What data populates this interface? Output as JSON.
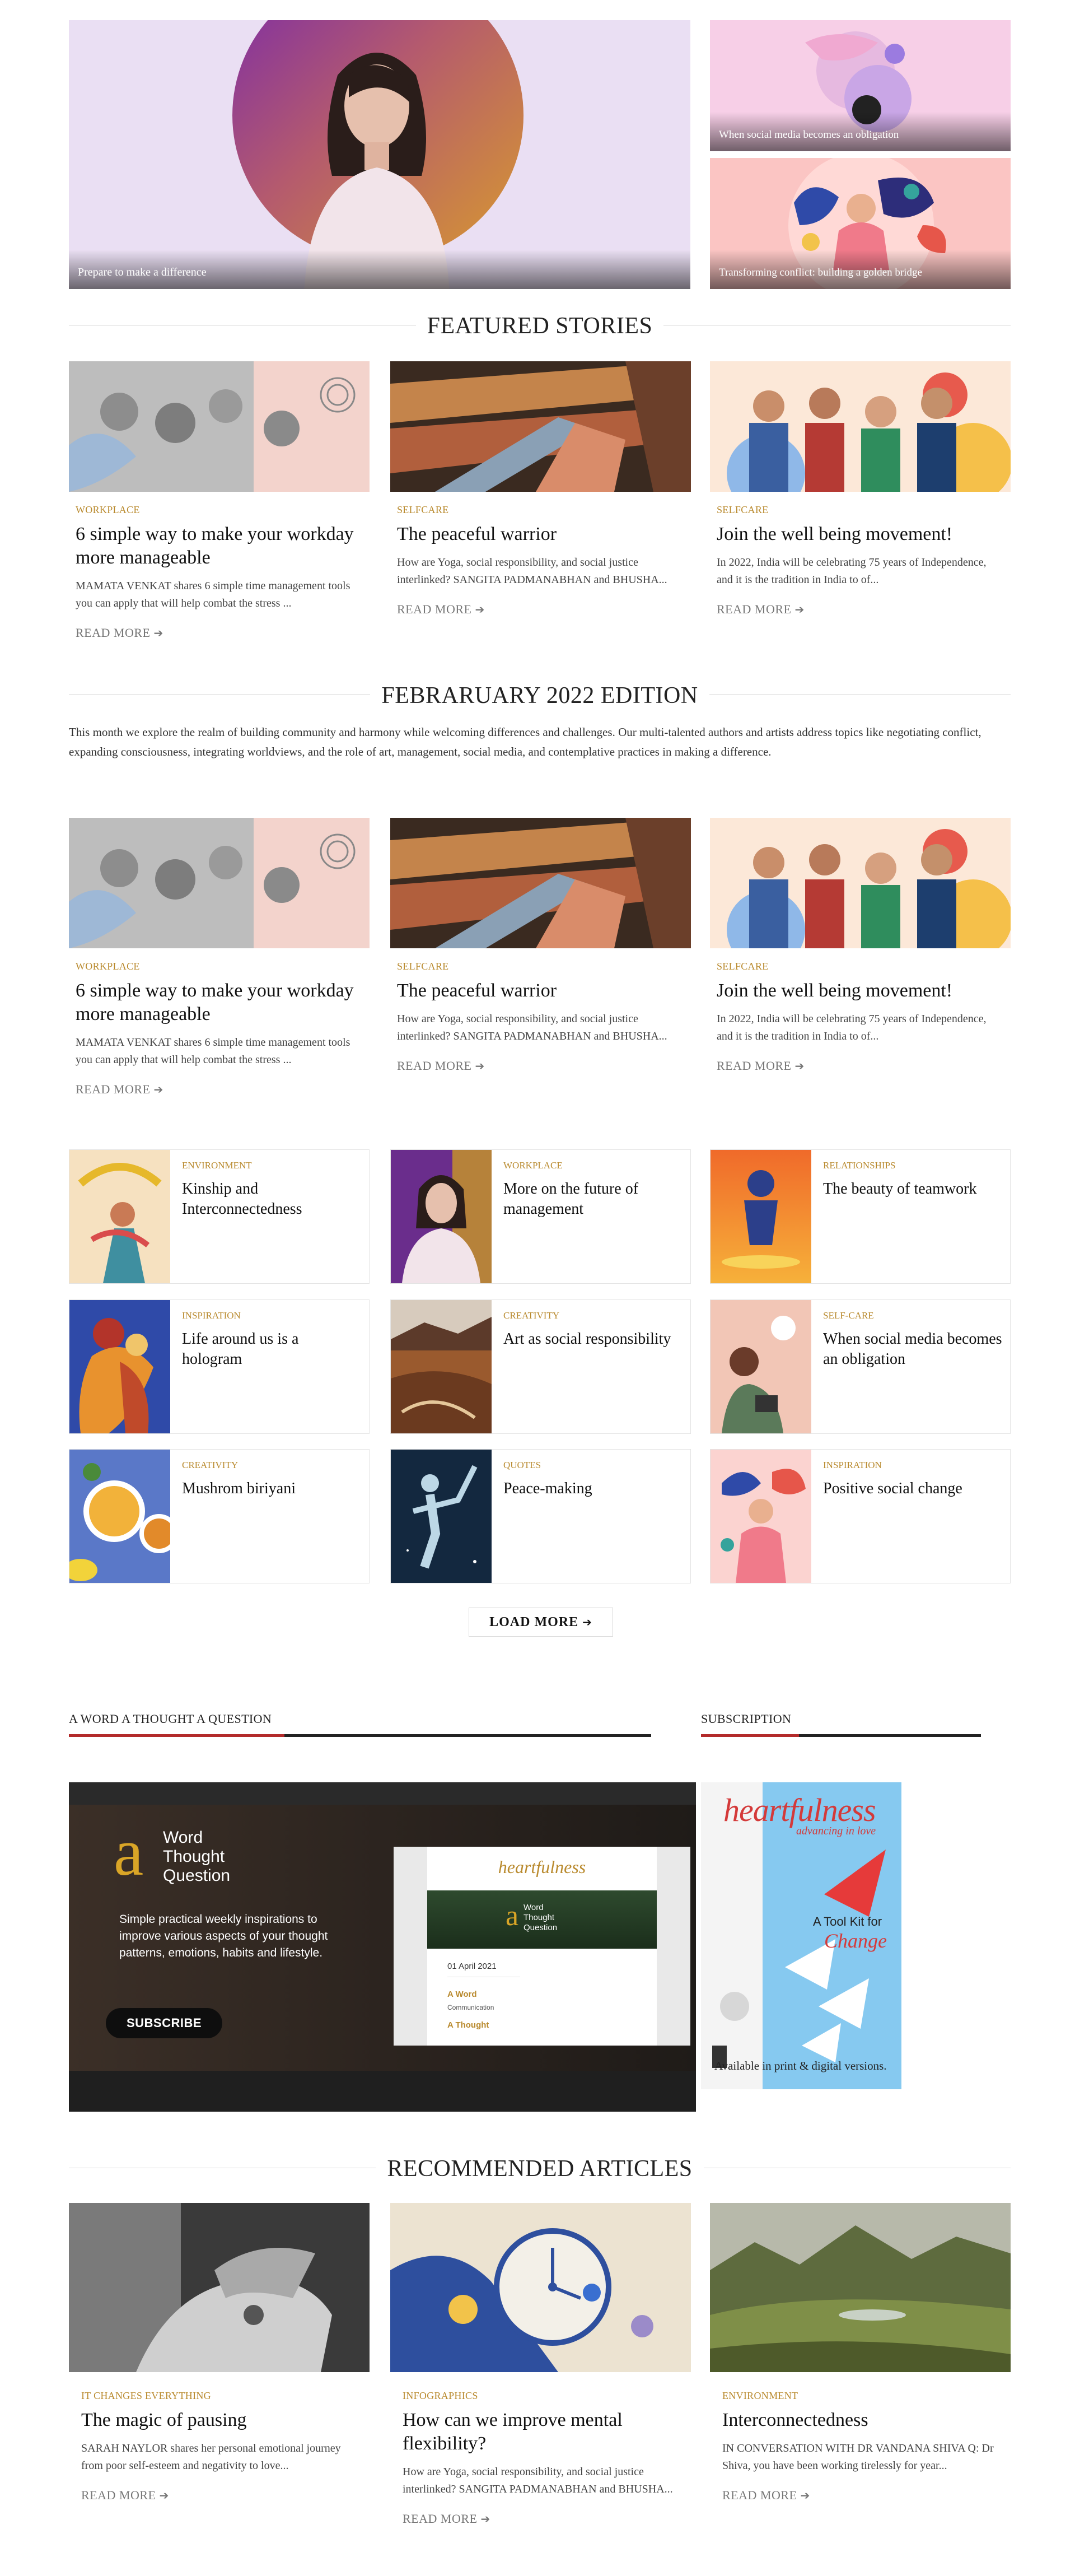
{
  "hero": {
    "main_caption": "Prepare to make a difference",
    "side1_caption": "When social media becomes an obligation",
    "side2_caption": "Transforming conflict: building a golden bridge"
  },
  "featured": {
    "heading": "FEATURED STORIES",
    "cards": [
      {
        "category": "WORKPLACE",
        "title": "6 simple way to make your workday more manageable",
        "excerpt": "MAMATA VENKAT shares 6 simple time management tools you can apply that will help combat the stress ...",
        "read_more": "READ MORE"
      },
      {
        "category": "SELFCARE",
        "title": "The peaceful warrior",
        "excerpt": "How are Yoga, social responsibility, and social justice interlinked? SANGITA PADMANABHAN and BHUSHA...",
        "read_more": "READ MORE"
      },
      {
        "category": "SELFCARE",
        "title": "Join the well being movement!",
        "excerpt": "In 2022, India will be celebrating 75 years of Independence, and it is the tradition in India to of...",
        "read_more": "READ MORE"
      }
    ]
  },
  "edition": {
    "heading": "FEBRARUARY 2022 EDITION",
    "intro": "This month we explore the realm of building community and harmony while welcoming differences and challenges. Our multi-talented authors and artists address topics like negotiating conflict, expanding consciousness, integrating worldviews, and the role of art, management, social media, and contemplative practices in making a difference.",
    "cards": [
      {
        "category": "WORKPLACE",
        "title": "6 simple way to make your workday more manageable",
        "excerpt": "MAMATA VENKAT shares 6 simple time management tools you can apply that will help combat the stress ...",
        "read_more": "READ MORE"
      },
      {
        "category": "SELFCARE",
        "title": "The peaceful warrior",
        "excerpt": "How are Yoga, social responsibility, and social justice interlinked? SANGITA PADMANABHAN and BHUSHA...",
        "read_more": "READ MORE"
      },
      {
        "category": "SELFCARE",
        "title": "Join the well being movement!",
        "excerpt": "In 2022, India will be celebrating 75 years of Independence, and it is the tradition in India to of...",
        "read_more": "READ MORE"
      }
    ],
    "tiles": [
      {
        "category": "ENVIRONMENT",
        "title": "Kinship and Interconnectedness"
      },
      {
        "category": "WORKPLACE",
        "title": "More on the future of management"
      },
      {
        "category": "RELATIONSHIPS",
        "title": "The beauty of teamwork"
      },
      {
        "category": "INSPIRATION",
        "title": "Life around us is a hologram"
      },
      {
        "category": "CREATIVITY",
        "title": "Art as social responsibility"
      },
      {
        "category": "SELF-CARE",
        "title": "When social media becomes an obligation"
      },
      {
        "category": "CREATIVITY",
        "title": "Mushrom biriyani"
      },
      {
        "category": "QUOTES",
        "title": "Peace-making"
      },
      {
        "category": "INSPIRATION",
        "title": "Positive social change"
      }
    ],
    "load_more": "LOAD MORE"
  },
  "word_thought": {
    "heading": "A WORD A THOUGHT A QUESTION",
    "logo_letter": "a",
    "logo_words": [
      "Word",
      "Thought",
      "Question"
    ],
    "description": "Simple practical weekly inspirations to improve various aspects of your thought patterns, emotions, habits and lifestyle.",
    "subscribe": "SUBSCRIBE",
    "preview_brand": "heartfulness",
    "preview_date": "01 April 2021",
    "preview_item1": "A Word",
    "preview_item1_sub": "Communication",
    "preview_item2": "A Thought"
  },
  "subscription": {
    "heading": "SUBSCRIPTION",
    "mag_brand": "heartfulness",
    "mag_tagline": "advancing in love",
    "mag_headline_1": "A Tool Kit for",
    "mag_headline_2": "Change",
    "available": "Available in print & digital versions."
  },
  "recommended": {
    "heading": "RECOMMENDED ARTICLES",
    "cards": [
      {
        "category": "IT CHANGES EVERYTHING",
        "title": "The magic of pausing",
        "excerpt": "SARAH NAYLOR shares her personal emotional journey from poor self-esteem and negativity to love...",
        "read_more": "READ MORE"
      },
      {
        "category": "INFOGRAPHICS",
        "title": "How can we improve mental flexibility?",
        "excerpt": "How are Yoga, social responsibility, and social justice interlinked? SANGITA PADMANABHAN and BHUSHA...",
        "read_more": "READ MORE"
      },
      {
        "category": "ENVIRONMENT",
        "title": "Interconnectedness",
        "excerpt": "IN CONVERSATION WITH DR VANDANA SHIVA Q: Dr Shiva, you have been working tirelessly for year...",
        "read_more": "READ MORE"
      }
    ]
  },
  "colors": {
    "accent_gold": "#b98a2e",
    "accent_red": "#b32a2a",
    "heading_text": "#222222"
  }
}
